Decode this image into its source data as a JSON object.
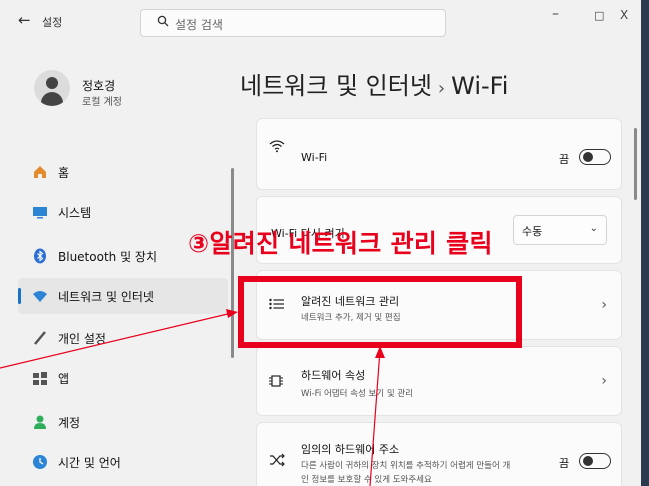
{
  "titlebar": {
    "back_icon": "back-arrow-icon",
    "title": "설정",
    "controls": [
      "–",
      "□",
      "X"
    ]
  },
  "search": {
    "placeholder": "설정 검색"
  },
  "user": {
    "name": "정호경",
    "account_type": "로컬 계정"
  },
  "sidebar": {
    "items": [
      {
        "label": "홈",
        "icon": "home-icon",
        "color": "#e38a2c"
      },
      {
        "label": "시스템",
        "icon": "system-icon",
        "color": "#2b84d6"
      },
      {
        "label": "Bluetooth 및 장치",
        "icon": "bluetooth-icon",
        "color": "#2b6fd6"
      },
      {
        "label": "네트워크 및 인터넷",
        "icon": "wifi-icon",
        "color": "#2b84d6",
        "active": true
      },
      {
        "label": "개인 설정",
        "icon": "brush-icon",
        "color": "#555555"
      },
      {
        "label": "앱",
        "icon": "apps-icon",
        "color": "#555555"
      },
      {
        "label": "계정",
        "icon": "account-icon",
        "color": "#2fae5a"
      },
      {
        "label": "시간 및 언어",
        "icon": "globe-clock-icon",
        "color": "#2b84d6"
      }
    ]
  },
  "breadcrumb": {
    "parent": "네트워크 및 인터넷",
    "separator": "›",
    "current": "Wi-Fi"
  },
  "cards": {
    "wifi": {
      "label": "Wi-Fi",
      "state": "끔",
      "icon": "wifi-icon"
    },
    "show_available": {
      "label": "Wi-Fi 다시 켜기",
      "value": "수동"
    },
    "known_networks": {
      "title": "알려진 네트워크 관리",
      "subtitle": "네트워크 추가, 제거 및 편집",
      "icon": "list-icon"
    },
    "hardware": {
      "title": "하드웨어 속성",
      "subtitle": "Wi-Fi 어댑터 속성 보기 및 관리",
      "icon": "chip-icon"
    },
    "random_mac": {
      "title": "임의의 하드웨어 주소",
      "subtitle": "다른 사람이 귀하의 장치 위치를 추적하기 어렵게 만들어 개",
      "subtitle2": "인 정보를 보호할 수 있게 도와주세요",
      "state": "끔",
      "icon": "shuffle-icon"
    }
  },
  "annotation": {
    "number": "③",
    "text": "알려진 네트워크 관리 클릭",
    "color": "#e8001c"
  }
}
